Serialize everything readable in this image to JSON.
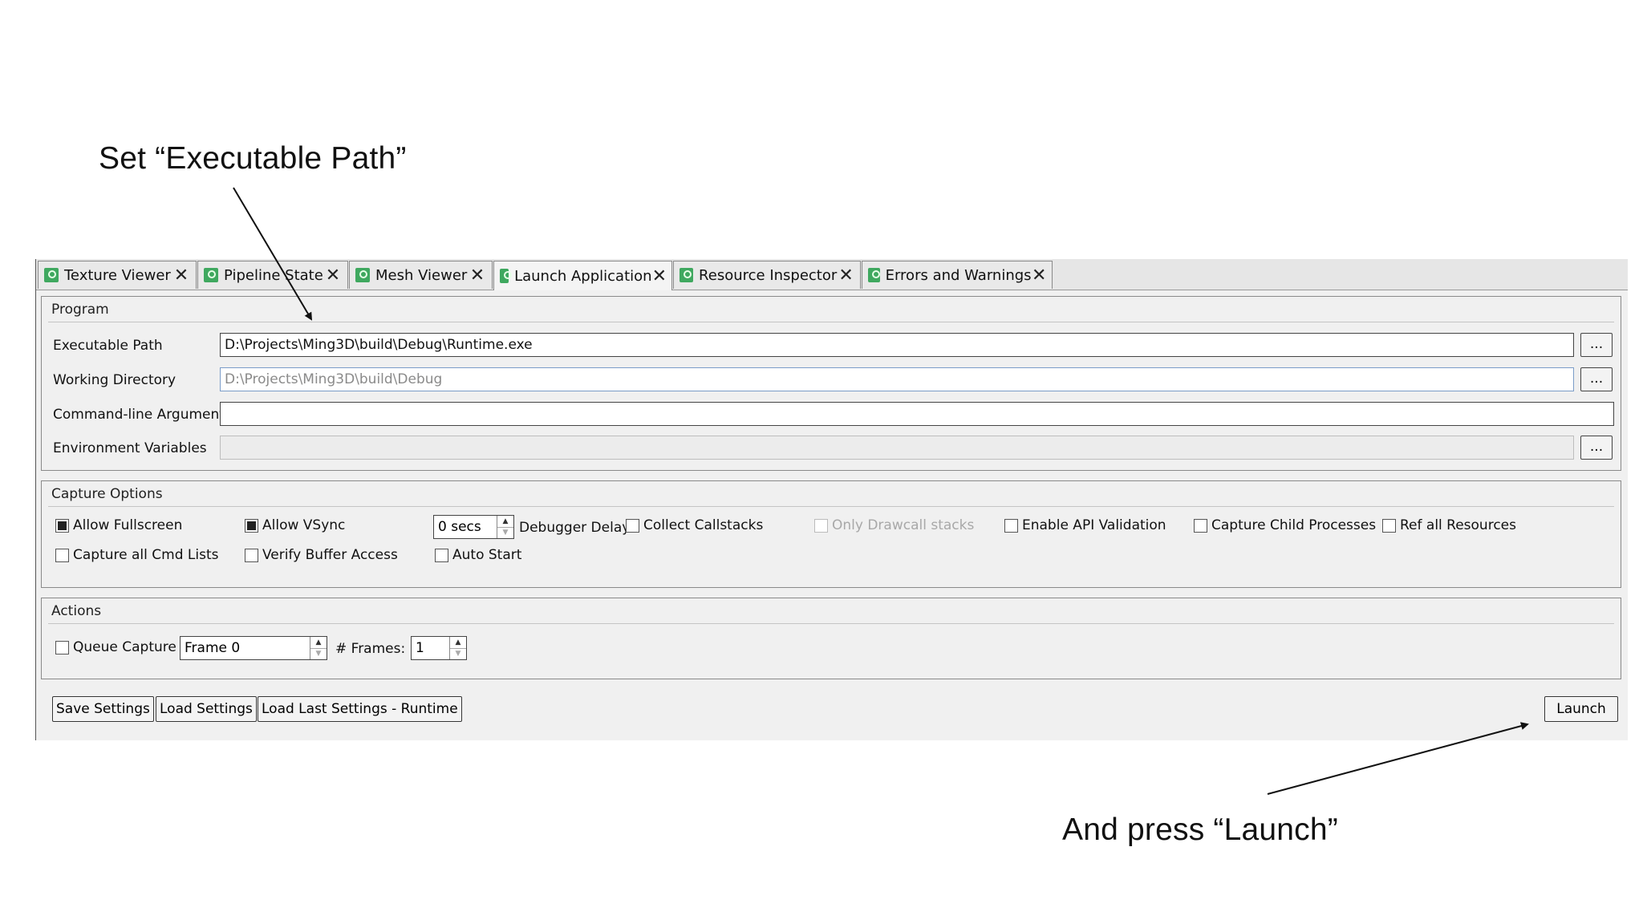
{
  "annotations": {
    "top": "Set “Executable Path”",
    "bottom": "And press “Launch”"
  },
  "tabs": [
    {
      "label": "Texture Viewer",
      "icon": "window-icon",
      "close": "✕"
    },
    {
      "label": "Pipeline State",
      "icon": "window-icon",
      "close": "✕"
    },
    {
      "label": "Mesh Viewer",
      "icon": "window-icon",
      "close": "✕"
    },
    {
      "label": "Launch Application",
      "icon": "window-icon",
      "close": "✕",
      "active": true
    },
    {
      "label": "Resource Inspector",
      "icon": "window-icon",
      "close": "✕"
    },
    {
      "label": "Errors and Warnings",
      "icon": "window-icon",
      "close": "✕"
    }
  ],
  "program": {
    "title": "Program",
    "executable_path_label": "Executable Path",
    "executable_path_value": "D:\\Projects\\Ming3D\\build\\Debug\\Runtime.exe",
    "working_directory_label": "Working Directory",
    "working_directory_placeholder": "D:\\Projects\\Ming3D\\build\\Debug",
    "cmdline_label": "Command-line Arguments",
    "cmdline_value": "",
    "env_label": "Environment Variables",
    "env_value": "",
    "browse_label": "..."
  },
  "capture": {
    "title": "Capture Options",
    "allow_fullscreen": "Allow Fullscreen",
    "allow_vsync": "Allow VSync",
    "debugger_delay_value": "0 secs",
    "debugger_delay_label": "Debugger Delay",
    "collect_callstacks": "Collect Callstacks",
    "only_drawcall_stacks": "Only Drawcall stacks",
    "enable_api_validation": "Enable API Validation",
    "capture_child_processes": "Capture Child Processes",
    "ref_all_resources": "Ref all Resources",
    "capture_all_cmd_lists": "Capture all Cmd Lists",
    "verify_buffer_access": "Verify Buffer Access",
    "auto_start": "Auto Start"
  },
  "actions": {
    "title": "Actions",
    "queue_capture": "Queue Capture",
    "frame_value": "Frame 0",
    "frames_label": "# Frames:",
    "frames_value": "1"
  },
  "buttons": {
    "save_settings": "Save Settings",
    "load_settings": "Load Settings",
    "load_last_settings": "Load Last Settings - Runtime",
    "launch": "Launch"
  },
  "spinner_arrows": {
    "up": "▲",
    "down": "▼"
  }
}
